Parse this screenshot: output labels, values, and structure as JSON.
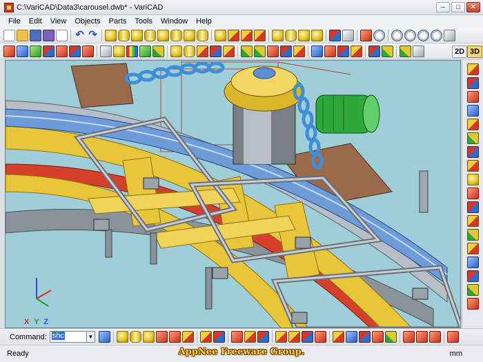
{
  "window": {
    "title": "C:\\VariCAD\\Data3\\carousel.dwb* - VariCAD",
    "minimize": "–",
    "maximize": "□",
    "close": "✕"
  },
  "menu": [
    "File",
    "Edit",
    "View",
    "Objects",
    "Parts",
    "Tools",
    "Window",
    "Help"
  ],
  "view_modes": {
    "two_d": "2D",
    "three_d": "3D",
    "active": "3D"
  },
  "viewport": {
    "axes": {
      "x": "X",
      "y": "Y",
      "z": "Z"
    },
    "colors": {
      "background": "#9fcdd8",
      "frame_yellow": "#e8c63a",
      "frame_red": "#d4402a",
      "rail_blue": "#5f8fd0",
      "steel": "#a8b0b8",
      "motor": "#2ea83a"
    }
  },
  "command": {
    "label": "Command:",
    "value": "shc"
  },
  "status": {
    "text": "Ready",
    "units": "mm"
  },
  "watermark": "AppNee Freeware Group."
}
